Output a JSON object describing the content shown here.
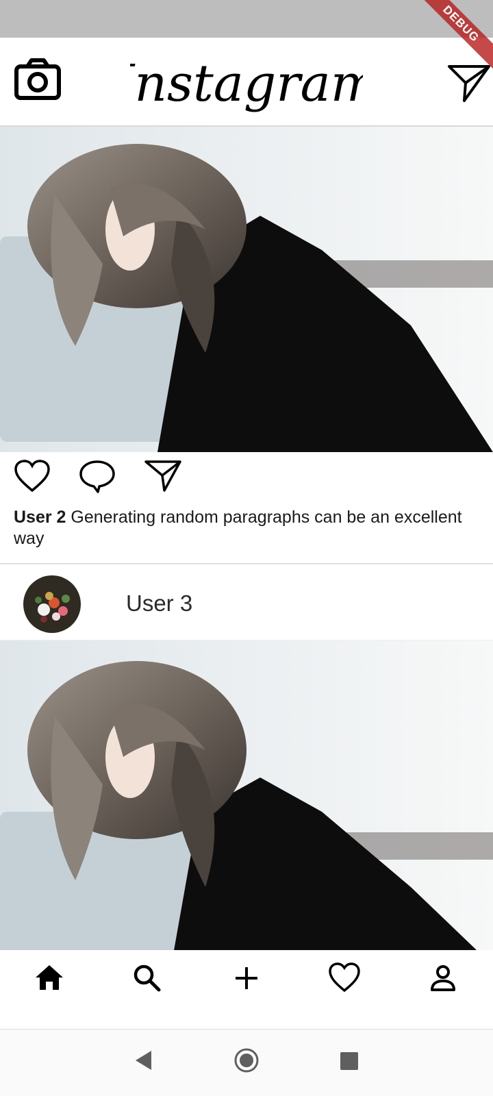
{
  "debug_banner": "DEBUG",
  "app_bar": {
    "logo_text": "Instagram",
    "left_icon": "camera-icon",
    "right_icon": "send-icon"
  },
  "post1": {
    "actions": [
      "heart-icon",
      "comment-icon",
      "send-icon"
    ],
    "caption_user": "User 2",
    "caption_text": " Generating random paragraphs can be an excellent way"
  },
  "post2": {
    "username": "User 3",
    "avatar": "flower-avatar"
  },
  "bottom_nav": {
    "items": [
      "home-icon",
      "search-icon",
      "add-icon",
      "heart-icon",
      "profile-icon"
    ]
  },
  "system_nav": {
    "items": [
      "back-icon",
      "home-circle-icon",
      "recents-icon"
    ]
  },
  "colors": {
    "status_bar": "#bdbdbd",
    "debug_banner": "#b71c1c",
    "text": "#1a1a1a"
  }
}
